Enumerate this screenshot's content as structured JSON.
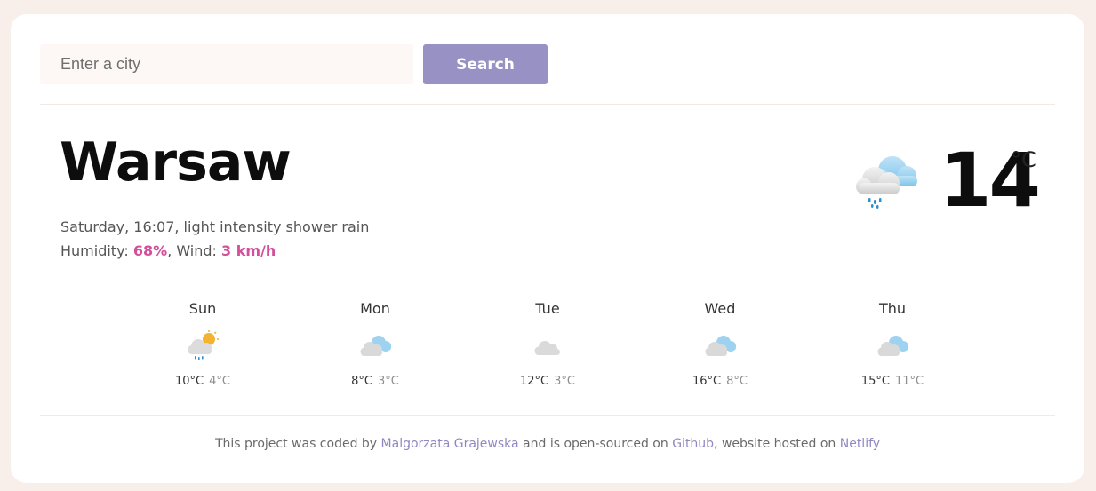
{
  "search": {
    "placeholder": "Enter a city",
    "value": "",
    "button_label": "Search"
  },
  "current": {
    "city": "Warsaw",
    "description": "Saturday, 16:07, light intensity shower rain",
    "humidity_label": "Humidity: ",
    "humidity_value": "68%",
    "separator": ", Wind: ",
    "wind_value": "3 km/h",
    "temperature": "14",
    "unit": "°C",
    "icon": "shower-rain-icon"
  },
  "forecast": [
    {
      "day": "Sun",
      "max": "10°C",
      "min": "4°C",
      "icon": "sun-cloud-rain-icon"
    },
    {
      "day": "Mon",
      "max": "8°C",
      "min": "3°C",
      "icon": "broken-clouds-icon"
    },
    {
      "day": "Tue",
      "max": "12°C",
      "min": "3°C",
      "icon": "scattered-clouds-icon"
    },
    {
      "day": "Wed",
      "max": "16°C",
      "min": "8°C",
      "icon": "broken-clouds-icon"
    },
    {
      "day": "Thu",
      "max": "15°C",
      "min": "11°C",
      "icon": "broken-clouds-icon"
    }
  ],
  "footer": {
    "text1": "This project was coded by ",
    "author_link": "Malgorzata Grajewska",
    "text2": " and is open-sourced on ",
    "github_link": "Github",
    "text3": ", website hosted on ",
    "netlify_link": "Netlify"
  },
  "colors": {
    "accent": "#9891c4",
    "highlight": "#d44f9a",
    "link": "#9088c2",
    "background": "#f8efea"
  }
}
